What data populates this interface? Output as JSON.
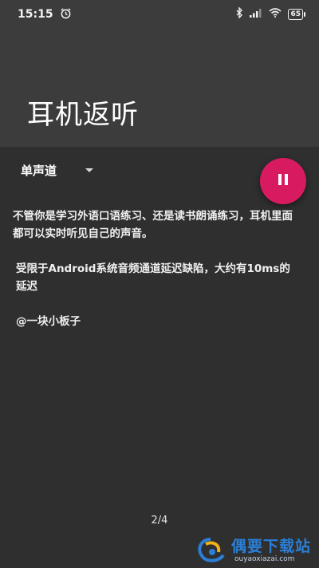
{
  "status_bar": {
    "time": "15:15",
    "battery": "65",
    "icons": [
      "alarm-icon",
      "bluetooth-icon",
      "signal-icon",
      "wifi-icon",
      "battery-icon"
    ]
  },
  "header": {
    "title": "耳机返听",
    "background": "#3c3c3d"
  },
  "channel": {
    "selected": "单声道"
  },
  "fab": {
    "icon": "pause-icon",
    "color": "#d81b60"
  },
  "description": {
    "line1": "不管你是学习外语口语练习、还是读书朗诵练习，耳机里面都可以实时听见自己的声音。",
    "line2": "受限于Android系统音频通道延迟缺陷，大约有10ms的延迟",
    "line3": "@一块小板子"
  },
  "pager": {
    "text": "2/4"
  },
  "watermark": {
    "brand": "偶要下载站",
    "url": "ouyaoxiazai.com"
  }
}
